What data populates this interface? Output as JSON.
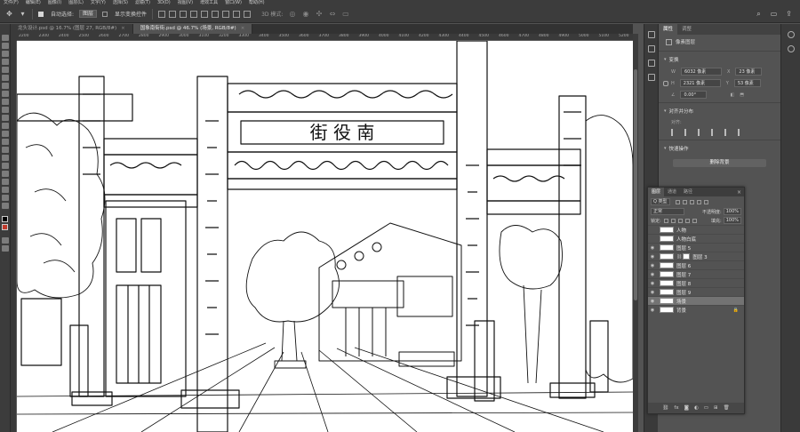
{
  "menubar": {
    "items": [
      "文件(F)",
      "编辑(E)",
      "图像(I)",
      "图层(L)",
      "文字(Y)",
      "选择(S)",
      "滤镜(T)",
      "3D(D)",
      "视图(V)",
      "增效工具",
      "窗口(W)",
      "帮助(H)"
    ]
  },
  "options": {
    "auto_select_label": "自动选择:",
    "auto_select_value": "图层",
    "show_transform_label": "显示变换控件",
    "mode_3d_label": "3D 模式:"
  },
  "tabs": [
    {
      "label": "龙头设计.psd @ 16.7% (图层 27, RGB/8#)",
      "close": "×"
    },
    {
      "label": "国象南街街.psd @ 46.7% (场景, RGB/8#)",
      "close": "×"
    }
  ],
  "ruler": {
    "ticks": [
      "2200",
      "2300",
      "2400",
      "2500",
      "2600",
      "2700",
      "2800",
      "2900",
      "3000",
      "3100",
      "3200",
      "3300",
      "3400",
      "3500",
      "3600",
      "3700",
      "3800",
      "3900",
      "4000",
      "4100",
      "4200",
      "4300",
      "4400",
      "4500",
      "4600",
      "4700",
      "4800",
      "4900",
      "5000",
      "5100",
      "5200"
    ]
  },
  "canvas": {
    "sign_text": "街 役 南"
  },
  "properties": {
    "tabs": [
      "属性",
      "调整"
    ],
    "subtitle": "像素图层",
    "transform_title": "变换",
    "w_label": "W",
    "w_value": "6032 像素",
    "x_label": "X",
    "x_value": "23 像素",
    "h_label": "H",
    "h_value": "2321 像素",
    "y_label": "Y",
    "y_value": "53 像素",
    "angle_value": "0.00°",
    "align_title": "对齐并分布",
    "align_label": "对齐:",
    "quick_title": "快速操作",
    "quick_button": "删除背景"
  },
  "layers_panel": {
    "tabs": [
      "图层",
      "通道",
      "路径"
    ],
    "close": "×",
    "kind_select": "Q 类型",
    "blend_mode": "正常",
    "opacity_label": "不透明度:",
    "opacity_value": "100%",
    "lock_label": "锁定:",
    "fill_label": "填充:",
    "fill_value": "100%",
    "layers": [
      {
        "name": "人物",
        "visible": false,
        "selected": false,
        "mask": false,
        "locked": false
      },
      {
        "name": "人物白底",
        "visible": false,
        "selected": false,
        "mask": false,
        "locked": false
      },
      {
        "name": "图层 5",
        "visible": true,
        "selected": false,
        "mask": false,
        "locked": false
      },
      {
        "name": "图层 3",
        "visible": true,
        "selected": false,
        "mask": true,
        "locked": false
      },
      {
        "name": "图层 6",
        "visible": true,
        "selected": false,
        "mask": false,
        "locked": false
      },
      {
        "name": "图层 7",
        "visible": true,
        "selected": false,
        "mask": false,
        "locked": false
      },
      {
        "name": "图层 8",
        "visible": true,
        "selected": false,
        "mask": false,
        "locked": false
      },
      {
        "name": "图层 9",
        "visible": true,
        "selected": false,
        "mask": false,
        "locked": false
      },
      {
        "name": "场景",
        "visible": true,
        "selected": true,
        "mask": false,
        "locked": false
      },
      {
        "name": "背景",
        "visible": true,
        "selected": false,
        "mask": false,
        "locked": true
      }
    ],
    "footer_icons": [
      "link-icon",
      "fx-icon",
      "mask-icon",
      "adjustment-icon",
      "folder-icon",
      "new-layer-icon",
      "trash-icon"
    ]
  }
}
